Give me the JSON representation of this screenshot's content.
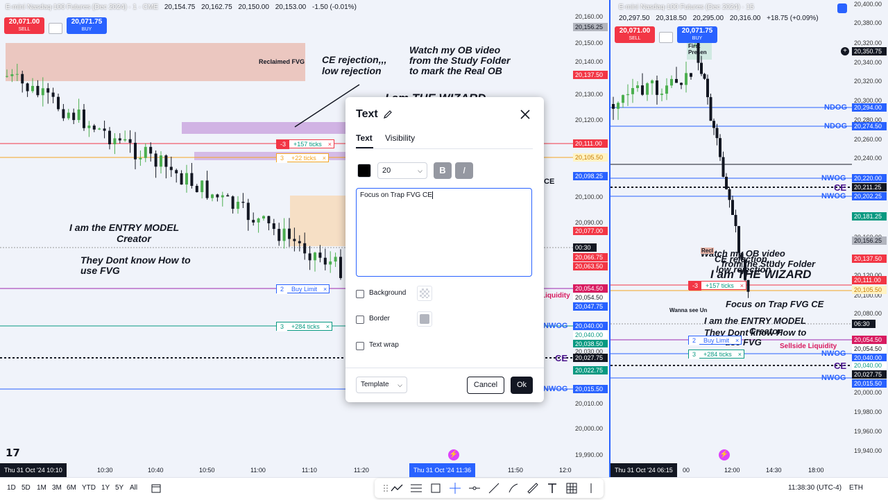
{
  "left_chart": {
    "symbol": "E-mini Nasdaq-100 Futures (Dec 2024) · 1 · CME",
    "ohlc": [
      "20,154.75",
      "20,162.75",
      "20,150.00",
      "20,153.00",
      "-1.50 (-0.01%)"
    ],
    "sell": {
      "price": "20,071.00",
      "label": "SELL"
    },
    "buy": {
      "price": "20,071.75",
      "label": "BUY"
    },
    "annotations": {
      "reclaimed_fvg": "Reclaimed FVG",
      "ce_rejection_1": "CE rejection,,,",
      "ce_rejection_2": "low rejection",
      "watch_ob_1": "Watch my OB video",
      "watch_ob_2": "from the Study Folder",
      "watch_ob_3": "to mark the Real OB",
      "wizard": "I am THE WIZARD",
      "entry_model_1": "I am the ENTRY MODEL",
      "entry_model_2": "Creator",
      "dont_know_1": "They Dont know How to",
      "dont_know_2": "use FVG",
      "liquidity": "Liquidity",
      "nwog_1": "NWOG",
      "nwog_2": "NWOG",
      "ce_label": "CE",
      "ce_partial": "CE"
    },
    "orders": [
      {
        "qty": "-3",
        "label": "+157 ticks",
        "close": "×"
      },
      {
        "qty": "3",
        "label": "+22 ticks",
        "close": "×"
      },
      {
        "qty": "2",
        "label": "Buy Limit",
        "close": "×"
      },
      {
        "qty": "3",
        "label": "+284 ticks",
        "close": "×"
      }
    ],
    "price_scale": [
      "20,160.00",
      "20,150.00",
      "20,140.00",
      "20,130.00",
      "20,120.00",
      "20,110.00",
      "20,100.00",
      "20,090.00",
      "20,080.00",
      "20,070.00",
      "20,060.00",
      "20,050.00",
      "20,040.00",
      "20,030.00",
      "20,020.00",
      "20,010.00",
      "20,000.00",
      "19,990.00"
    ],
    "price_tags": {
      "t1": "20,156.25",
      "t2": "20,137.50",
      "t3": "20,111.00",
      "t4": "20,105.50",
      "t5": "20,098.25",
      "t6": "20,077.00",
      "t7": "00:30",
      "t8": "20,066.75",
      "t9": "20,063.50",
      "t10": "20,054.50",
      "t11": "20,054.50",
      "t12": "20,047.75",
      "t13": "20,040.00",
      "t14": "20,040.00",
      "t15": "20,038.50",
      "t16": "20,030.00",
      "t17": "20,027.75",
      "t18": "20,022.75",
      "t19": "20,015.50"
    },
    "time_axis": [
      "10:30",
      "10:40",
      "10:50",
      "11:00",
      "11:10",
      "11:20",
      "11:50",
      "12:0"
    ],
    "time_start": "Thu 31 Oct '24  10:10",
    "time_cursor": "Thu 31 Oct '24  11:36"
  },
  "right_chart": {
    "symbol": "E-mini Nasdaq-100 Futures (Dec 2024) · 15",
    "ohlc": [
      "20,297.50",
      "20,318.50",
      "20,295.00",
      "20,316.00",
      "+18.75 (+0.09%)"
    ],
    "sell": {
      "price": "20,071.00",
      "label": "SELL"
    },
    "buy": {
      "price": "20,071.75",
      "label": "BUY"
    },
    "annotations": {
      "first_presented": "First Presen",
      "ndog_1": "NDOG",
      "ndog_2": "NDOG",
      "nwog_1": "NWOG",
      "ce_1": "CE",
      "nwog_2": "NWOG",
      "watch_ob": "Watch my OB video",
      "ce_rejection": "CE rejection,,,",
      "from_study": "from the Study Folder",
      "low_rejection": "low rejection",
      "wizard": "I am THE WIZARD",
      "focus": "Focus on Trap FVG CE",
      "wanna_see": "Wanna see Un",
      "entry_model": "I am the ENTRY MODEL",
      "dont_know": "They Dont know How to",
      "creator": "Creator",
      "use_fvg": "use FVG",
      "sellside": "Sellside Liquidity",
      "nwog_3": "NWOG",
      "ce_2": "CE",
      "nwog_4": "NWOG",
      "recl": "Recl"
    },
    "orders": [
      {
        "qty": "-3",
        "label": "+157 ticks",
        "close": "×"
      },
      {
        "qty": "3",
        "label": "+22 ticks",
        "close": "×"
      },
      {
        "qty": "2",
        "label": "Buy Limit",
        "close": "×"
      },
      {
        "qty": "3",
        "label": "+284 ticks",
        "close": "×"
      }
    ],
    "price_scale": [
      "20,400.00",
      "20,380.00",
      "20,340.00",
      "20,320.00",
      "20,300.00",
      "20,260.00",
      "20,240.00",
      "20,160.00",
      "20,140.00",
      "20,120.00",
      "20,100.00",
      "20,080.00",
      "20,060.00",
      "20,000.00",
      "19,980.00",
      "19,960.00",
      "19,940.00"
    ],
    "price_tags": {
      "t1": "20,350.75",
      "t2": "20,294.00",
      "t3": "20,274.50",
      "t4": "20,220.00",
      "t5": "20,211.25",
      "t6": "20,202.25",
      "t7": "20,181.25",
      "t8": "20,156.25",
      "t9": "20,137.50",
      "t10": "20,111.00",
      "t11": "20,105.50",
      "t12": "06:30",
      "t13": "20,054.50",
      "t14": "20,054.50",
      "t15": "20,040.00",
      "t16": "20,040.00",
      "t17": "20,027.75",
      "t18": "20,015.50",
      "t19": "20,320.00",
      "t20": "20,280.00",
      "t21": "20,100.00"
    },
    "time_axis": [
      "12:00",
      "14:30",
      "18:00"
    ],
    "time_start": "Thu 31 Oct '24  06:15",
    "time_partial": "00"
  },
  "dialog": {
    "title": "Text",
    "tabs": [
      "Text",
      "Visibility"
    ],
    "font_size": "20",
    "bold": "B",
    "italic": "I",
    "text_value": "Focus on Trap FVG CE",
    "background_label": "Background",
    "border_label": "Border",
    "text_wrap_label": "Text wrap",
    "template_label": "Template",
    "cancel_label": "Cancel",
    "ok_label": "Ok",
    "text_color": "#000000"
  },
  "bottom_bar": {
    "ranges": [
      "1D",
      "5D",
      "1M",
      "3M",
      "6M",
      "YTD",
      "1Y",
      "5Y",
      "All"
    ],
    "clock": "11:38:30 (UTC-4)",
    "session": "ETH"
  },
  "colors": {
    "buy_blue": "#2962ff",
    "sell_red": "#f23645",
    "order_green": "#089981",
    "order_yellow": "#f5a623",
    "nwog_blue": "#2962ff"
  }
}
